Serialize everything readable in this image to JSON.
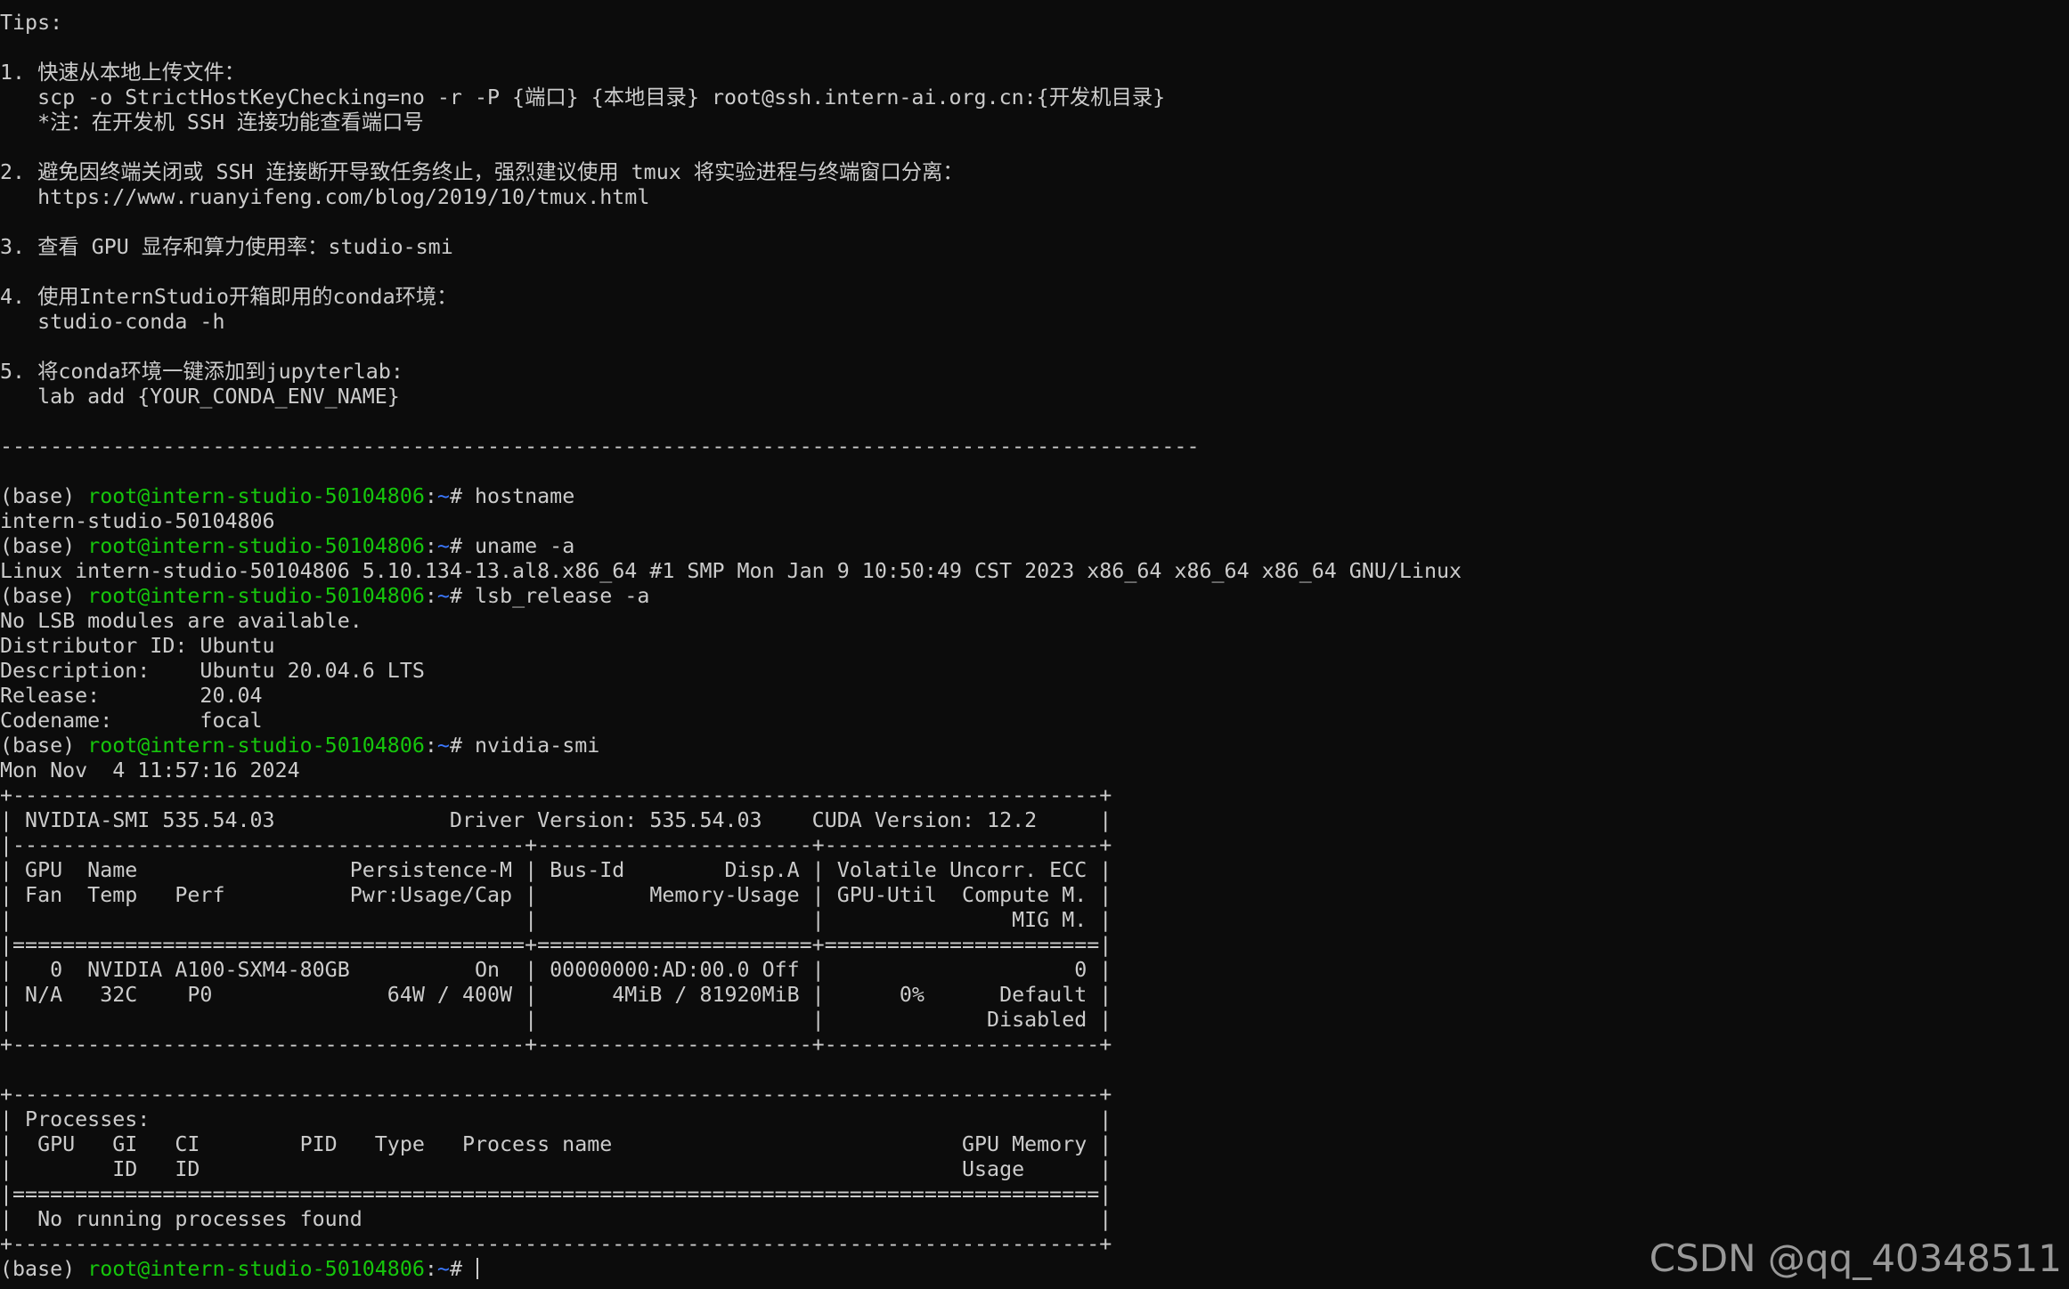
{
  "terminal": {
    "lines": [
      {
        "text": ""
      },
      {
        "text": "Tips:"
      },
      {
        "text": ""
      },
      {
        "text": "1. 快速从本地上传文件："
      },
      {
        "text": "   scp -o StrictHostKeyChecking=no -r -P {端口} {本地目录} root@ssh.intern-ai.org.cn:{开发机目录}"
      },
      {
        "text": "   *注：在开发机 SSH 连接功能查看端口号"
      },
      {
        "text": ""
      },
      {
        "text": "2. 避免因终端关闭或 SSH 连接断开导致任务终止，强烈建议使用 tmux 将实验进程与终端窗口分离："
      },
      {
        "text": "   https://www.ruanyifeng.com/blog/2019/10/tmux.html"
      },
      {
        "text": ""
      },
      {
        "text": "3. 查看 GPU 显存和算力使用率：studio-smi"
      },
      {
        "text": ""
      },
      {
        "text": "4. 使用InternStudio开箱即用的conda环境："
      },
      {
        "text": "   studio-conda -h"
      },
      {
        "text": ""
      },
      {
        "text": "5. 将conda环境一键添加到jupyterlab:"
      },
      {
        "text": "   lab add {YOUR_CONDA_ENV_NAME}"
      },
      {
        "text": ""
      },
      {
        "text": "------------------------------------------------------------------------------------------------"
      },
      {
        "text": ""
      },
      {
        "prompt": {
          "env": "(base) ",
          "user": "root@intern-studio-50104806",
          "colon": ":",
          "path": "~",
          "sym": "# ",
          "cmd": "hostname"
        }
      },
      {
        "text": "intern-studio-50104806"
      },
      {
        "prompt": {
          "env": "(base) ",
          "user": "root@intern-studio-50104806",
          "colon": ":",
          "path": "~",
          "sym": "# ",
          "cmd": "uname -a"
        }
      },
      {
        "text": "Linux intern-studio-50104806 5.10.134-13.al8.x86_64 #1 SMP Mon Jan 9 10:50:49 CST 2023 x86_64 x86_64 x86_64 GNU/Linux"
      },
      {
        "prompt": {
          "env": "(base) ",
          "user": "root@intern-studio-50104806",
          "colon": ":",
          "path": "~",
          "sym": "# ",
          "cmd": "lsb_release -a"
        }
      },
      {
        "text": "No LSB modules are available."
      },
      {
        "text": "Distributor ID: Ubuntu"
      },
      {
        "text": "Description:    Ubuntu 20.04.6 LTS"
      },
      {
        "text": "Release:        20.04"
      },
      {
        "text": "Codename:       focal"
      },
      {
        "prompt": {
          "env": "(base) ",
          "user": "root@intern-studio-50104806",
          "colon": ":",
          "path": "~",
          "sym": "# ",
          "cmd": "nvidia-smi"
        }
      },
      {
        "text": "Mon Nov  4 11:57:16 2024"
      },
      {
        "text": "+---------------------------------------------------------------------------------------+"
      },
      {
        "text": "| NVIDIA-SMI 535.54.03              Driver Version: 535.54.03    CUDA Version: 12.2     |"
      },
      {
        "text": "|-----------------------------------------+----------------------+----------------------+"
      },
      {
        "text": "| GPU  Name                 Persistence-M | Bus-Id        Disp.A | Volatile Uncorr. ECC |"
      },
      {
        "text": "| Fan  Temp   Perf          Pwr:Usage/Cap |         Memory-Usage | GPU-Util  Compute M. |"
      },
      {
        "text": "|                                         |                      |               MIG M. |"
      },
      {
        "text": "|=========================================+======================+======================|"
      },
      {
        "text": "|   0  NVIDIA A100-SXM4-80GB          On  | 00000000:AD:00.0 Off |                    0 |"
      },
      {
        "text": "| N/A   32C    P0              64W / 400W |      4MiB / 81920MiB |      0%      Default |"
      },
      {
        "text": "|                                         |                      |             Disabled |"
      },
      {
        "text": "+-----------------------------------------+----------------------+----------------------+"
      },
      {
        "text": ""
      },
      {
        "text": "+---------------------------------------------------------------------------------------+"
      },
      {
        "text": "| Processes:                                                                            |"
      },
      {
        "text": "|  GPU   GI   CI        PID   Type   Process name                            GPU Memory |"
      },
      {
        "text": "|        ID   ID                                                             Usage      |"
      },
      {
        "text": "|=======================================================================================|"
      },
      {
        "text": "|  No running processes found                                                           |"
      },
      {
        "text": "+---------------------------------------------------------------------------------------+"
      },
      {
        "prompt": {
          "env": "(base) ",
          "user": "root@intern-studio-50104806",
          "colon": ":",
          "path": "~",
          "sym": "# ",
          "cmd": ""
        },
        "cursor": true
      }
    ]
  },
  "watermark": "CSDN @qq_40348511",
  "colors": {
    "background": "#0c0c0c",
    "foreground": "#cccccc",
    "prompt_user": "#16c60c",
    "prompt_path": "#3b78ff"
  }
}
